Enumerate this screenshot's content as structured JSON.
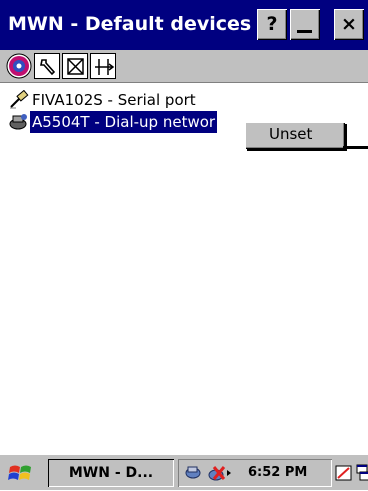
{
  "window": {
    "title": "MWN - Default devices",
    "help_label": "?",
    "close_label": "×"
  },
  "toolbar": {
    "tools": [
      "network-globe-icon",
      "wrench-icon",
      "delete-box-icon",
      "connector-icon"
    ]
  },
  "devices": [
    {
      "name": "FIVA102S - Serial port",
      "icon": "serial-port-icon",
      "selected": false
    },
    {
      "name": "A5504T - Dial-up networ",
      "icon": "dialup-network-icon",
      "selected": true
    }
  ],
  "context_menu": {
    "items": [
      "Unset"
    ]
  },
  "taskbar": {
    "task_label": "MWN - D...",
    "clock": "6:52 PM"
  },
  "colors": {
    "titlebar": "#000080",
    "face": "#c0c0c0",
    "selection": "#000080"
  }
}
